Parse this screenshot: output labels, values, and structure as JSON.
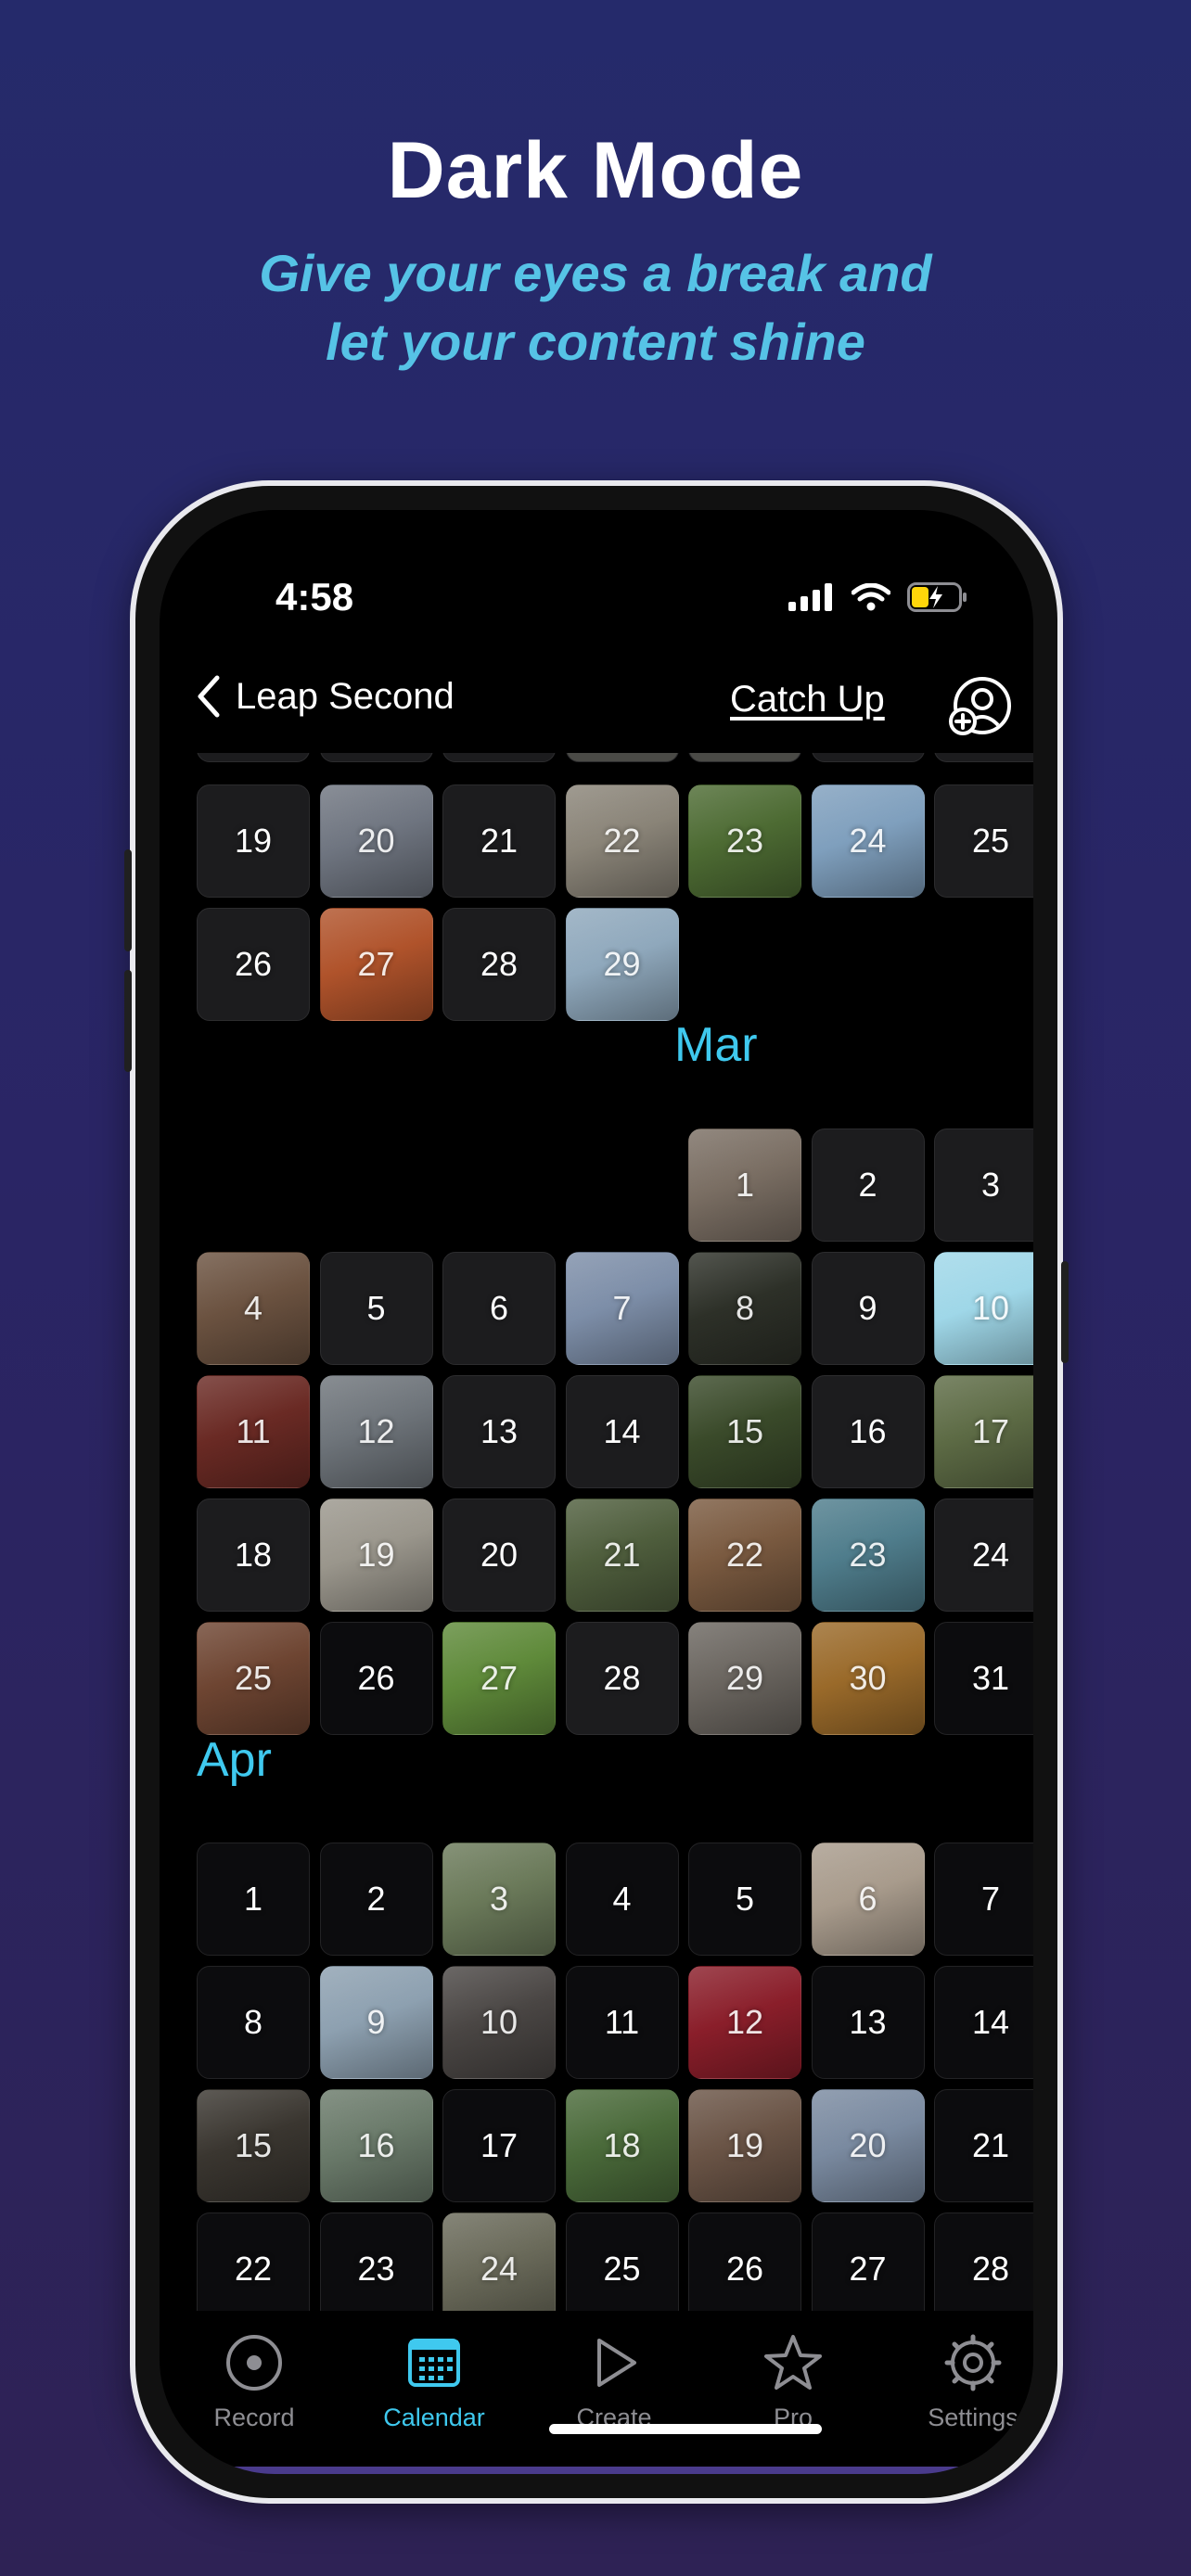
{
  "promo": {
    "headline": "Dark Mode",
    "sub_line1": "Give your eyes a break and",
    "sub_line2": "let your content shine"
  },
  "status_bar": {
    "time": "4:58"
  },
  "nav": {
    "back_label": "Leap Second",
    "catch_up": "Catch Up"
  },
  "months": [
    {
      "label": "",
      "weeks": [
        [
          {
            "day": "19",
            "photo": ""
          },
          {
            "day": "20",
            "photo": "#6f7580"
          },
          {
            "day": "21",
            "photo": ""
          },
          {
            "day": "22",
            "photo": "#8a8478"
          },
          {
            "day": "23",
            "photo": "#4d6b33"
          },
          {
            "day": "24",
            "photo": "#7f9fbd"
          },
          {
            "day": "25",
            "photo": ""
          }
        ],
        [
          {
            "day": "26",
            "photo": ""
          },
          {
            "day": "27",
            "photo": "#b0532b"
          },
          {
            "day": "28",
            "photo": ""
          },
          {
            "day": "29",
            "photo": "#8fa8bc"
          },
          null,
          null,
          null
        ]
      ]
    },
    {
      "label": "Mar",
      "weeks": [
        [
          null,
          null,
          null,
          null,
          {
            "day": "1",
            "photo": "#7a6e63"
          },
          {
            "day": "2",
            "photo": ""
          },
          {
            "day": "3",
            "photo": ""
          }
        ],
        [
          {
            "day": "4",
            "photo": "#6b5240"
          },
          {
            "day": "5",
            "photo": ""
          },
          {
            "day": "6",
            "photo": ""
          },
          {
            "day": "7",
            "photo": "#7d8ea8"
          },
          {
            "day": "8",
            "photo": "#2d3028"
          },
          {
            "day": "9",
            "photo": ""
          },
          {
            "day": "10",
            "photo": "#9fd7e8"
          }
        ],
        [
          {
            "day": "11",
            "photo": "#6a2a24"
          },
          {
            "day": "12",
            "photo": "#6e747a"
          },
          {
            "day": "13",
            "photo": ""
          },
          {
            "day": "14",
            "photo": ""
          },
          {
            "day": "15",
            "photo": "#3a4a2a"
          },
          {
            "day": "16",
            "photo": ""
          },
          {
            "day": "17",
            "photo": "#5d6b45"
          }
        ],
        [
          {
            "day": "18",
            "photo": ""
          },
          {
            "day": "19",
            "photo": "#9a968c"
          },
          {
            "day": "20",
            "photo": ""
          },
          {
            "day": "21",
            "photo": "#4f5e3d"
          },
          {
            "day": "22",
            "photo": "#7a5a40"
          },
          {
            "day": "23",
            "photo": "#4f7d8c"
          },
          {
            "day": "24",
            "photo": ""
          }
        ],
        [
          {
            "day": "25",
            "photo": "#6e4532"
          },
          {
            "day": "26",
            "photo": "dim"
          },
          {
            "day": "27",
            "photo": "#5f8a3a"
          },
          {
            "day": "28",
            "photo": ""
          },
          {
            "day": "29",
            "photo": "#6b6660"
          },
          {
            "day": "30",
            "photo": "#9a6a2a"
          },
          {
            "day": "31",
            "photo": "dim"
          }
        ]
      ]
    },
    {
      "label": "Apr",
      "weeks": [
        [
          {
            "day": "1",
            "photo": "dim"
          },
          {
            "day": "2",
            "photo": "dim"
          },
          {
            "day": "3",
            "photo": "#6b7a5a"
          },
          {
            "day": "4",
            "photo": "dim"
          },
          {
            "day": "5",
            "photo": "dim"
          },
          {
            "day": "6",
            "photo": "#a89b8c"
          },
          {
            "day": "7",
            "photo": "dim"
          }
        ],
        [
          {
            "day": "8",
            "photo": "dim"
          },
          {
            "day": "9",
            "photo": "#8da0b0"
          },
          {
            "day": "10",
            "photo": "#4a4644"
          },
          {
            "day": "11",
            "photo": "dim"
          },
          {
            "day": "12",
            "photo": "#8a1e2a"
          },
          {
            "day": "13",
            "photo": "dim"
          },
          {
            "day": "14",
            "photo": "dim"
          }
        ],
        [
          {
            "day": "15",
            "photo": "#3a3630"
          },
          {
            "day": "16",
            "photo": "#6a7a6a"
          },
          {
            "day": "17",
            "photo": "dim"
          },
          {
            "day": "18",
            "photo": "#4a6a3a"
          },
          {
            "day": "19",
            "photo": "#6a5446"
          },
          {
            "day": "20",
            "photo": "#7a8aa0"
          },
          {
            "day": "21",
            "photo": "dim"
          }
        ],
        [
          {
            "day": "22",
            "photo": "dim"
          },
          {
            "day": "23",
            "photo": "dim"
          },
          {
            "day": "24",
            "photo": "#6a6a5a"
          },
          {
            "day": "25",
            "photo": "dim"
          },
          {
            "day": "26",
            "photo": "dim"
          },
          {
            "day": "27",
            "photo": "dim"
          },
          {
            "day": "28",
            "photo": "dim"
          }
        ]
      ]
    }
  ],
  "tabs": [
    {
      "label": "Record",
      "icon": "record-icon",
      "active": false
    },
    {
      "label": "Calendar",
      "icon": "calendar-icon",
      "active": true
    },
    {
      "label": "Create",
      "icon": "play-icon",
      "active": false
    },
    {
      "label": "Pro",
      "icon": "star-icon",
      "active": false
    },
    {
      "label": "Settings",
      "icon": "gear-icon",
      "active": false
    }
  ],
  "colors": {
    "accent": "#3fc9ef",
    "background": "#000000",
    "cell": "#1c1c1e"
  }
}
